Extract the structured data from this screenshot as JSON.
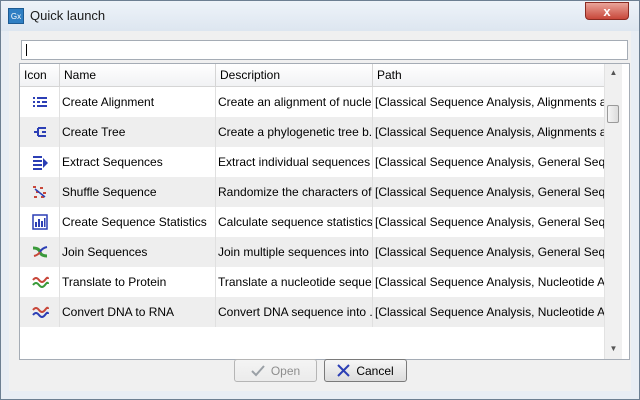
{
  "window": {
    "title": "Quick launch",
    "app_icon_text": "Gx",
    "close_label": "x"
  },
  "search": {
    "value": ""
  },
  "table": {
    "headers": {
      "icon": "Icon",
      "name": "Name",
      "description": "Description",
      "path": "Path"
    },
    "rows": [
      {
        "icon": "alignment-icon",
        "name": "Create Alignment",
        "description": "Create an alignment of nucle...",
        "path": "[Classical Sequence Analysis, Alignments an..."
      },
      {
        "icon": "tree-icon",
        "name": "Create Tree",
        "description": "Create a phylogenetic tree b...",
        "path": "[Classical Sequence Analysis, Alignments an..."
      },
      {
        "icon": "extract-sequences-icon",
        "name": "Extract Sequences",
        "description": "Extract individual sequences ...",
        "path": "[Classical Sequence Analysis, General Seque..."
      },
      {
        "icon": "shuffle-icon",
        "name": "Shuffle Sequence",
        "description": "Randomize the characters of...",
        "path": "[Classical Sequence Analysis, General Seque..."
      },
      {
        "icon": "statistics-icon",
        "name": "Create Sequence Statistics",
        "description": "Calculate sequence statistics...",
        "path": "[Classical Sequence Analysis, General Seque..."
      },
      {
        "icon": "join-sequences-icon",
        "name": "Join Sequences",
        "description": "Join multiple sequences into ...",
        "path": "[Classical Sequence Analysis, General Seque..."
      },
      {
        "icon": "translate-icon",
        "name": "Translate to Protein",
        "description": "Translate a nucleotide seque...",
        "path": "[Classical Sequence Analysis, Nucleotide An..."
      },
      {
        "icon": "dna-to-rna-icon",
        "name": "Convert DNA to RNA",
        "description": "Convert DNA sequence into ...",
        "path": "[Classical Sequence Analysis, Nucleotide An..."
      }
    ]
  },
  "buttons": {
    "open_label": "Open",
    "cancel_label": "Cancel"
  },
  "colors": {
    "accent_blue": "#2c3fb5",
    "red": "#c8473a",
    "green": "#3a9a3a"
  }
}
